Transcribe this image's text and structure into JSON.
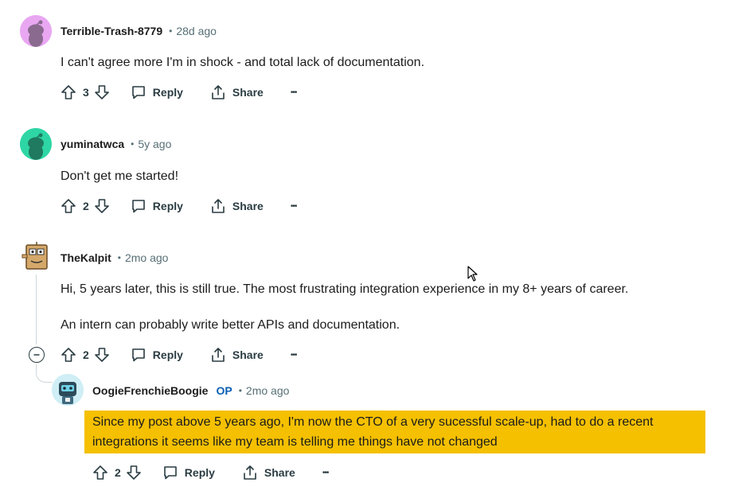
{
  "comments": [
    {
      "author": "Terrible-Trash-8779",
      "time": "28d ago",
      "text": "I can't agree more I'm in shock - and total lack of documentation.",
      "votes": "3",
      "reply_label": "Reply",
      "share_label": "Share",
      "more_label": "•••",
      "avatar_color": "#e9a7f2"
    },
    {
      "author": "yuminatwca",
      "time": "5y ago",
      "text": "Don't get me started!",
      "votes": "2",
      "reply_label": "Reply",
      "share_label": "Share",
      "more_label": "•••",
      "avatar_color": "#2ed6a5"
    },
    {
      "author": "TheKalpit",
      "time": "2mo ago",
      "text_lines": [
        "Hi, 5 years later, this is still true. The most frustrating integration experience in my 8+ years of career.",
        "An intern can probably write better APIs and documentation."
      ],
      "votes": "2",
      "reply_label": "Reply",
      "share_label": "Share",
      "more_label": "•••"
    },
    {
      "author": "OogieFrenchieBoogie",
      "op_badge": "OP",
      "time": "2mo ago",
      "text": "Since my post above 5 years ago, I'm now the CTO of a very sucessful scale-up, had to do a recent integrations it seems like my team is telling me things have not changed",
      "votes": "2",
      "reply_label": "Reply",
      "share_label": "Share",
      "more_label": "•••",
      "highlight_color": "#f5c000"
    }
  ],
  "separator": "•"
}
